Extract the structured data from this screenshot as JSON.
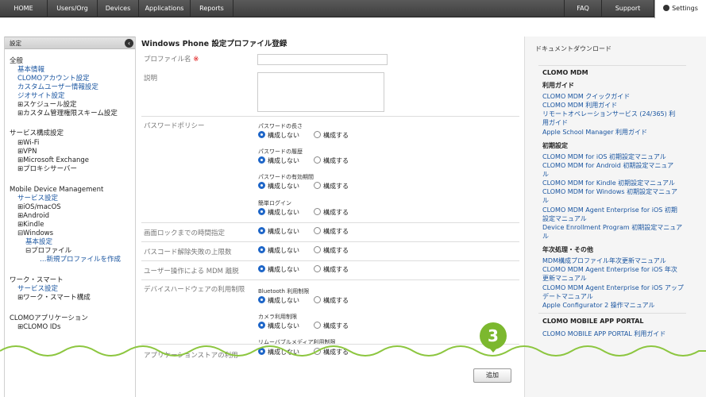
{
  "topnav": {
    "items": [
      "HOME",
      "Users/Org",
      "Devices",
      "Applications",
      "Reports",
      "FAQ",
      "Support"
    ],
    "settings": "Settings"
  },
  "sidebar": {
    "header": "設定",
    "collapse_icon": "chevron-left-icon",
    "groups": [
      {
        "title": "全般",
        "items": [
          {
            "label": "基本情報",
            "type": "link"
          },
          {
            "label": "CLOMOアカウント設定",
            "type": "link"
          },
          {
            "label": "カスタムユーザー情報設定",
            "type": "link"
          },
          {
            "label": "ジオサイト設定",
            "type": "link"
          },
          {
            "label": "⊞スケジュール設定",
            "type": "text"
          },
          {
            "label": "⊞カスタム管理権限スキーム設定",
            "type": "text"
          }
        ]
      },
      {
        "title": "サービス構成設定",
        "items": [
          {
            "label": "⊞Wi-Fi",
            "type": "text"
          },
          {
            "label": "⊞VPN",
            "type": "text"
          },
          {
            "label": "⊞Microsoft Exchange",
            "type": "text"
          },
          {
            "label": "⊞プロキシサーバー",
            "type": "text"
          }
        ]
      },
      {
        "title": "Mobile Device Management",
        "items": [
          {
            "label": "サービス設定",
            "type": "link"
          },
          {
            "label": "⊞iOS/macOS",
            "type": "text"
          },
          {
            "label": "⊞Android",
            "type": "text"
          },
          {
            "label": "⊞Kindle",
            "type": "text"
          },
          {
            "label": "⊟Windows",
            "type": "text"
          },
          {
            "label": "基本設定",
            "type": "link"
          },
          {
            "label": "⊟プロファイル",
            "type": "text"
          },
          {
            "label": "…新規プロファイルを作成",
            "type": "link"
          }
        ]
      },
      {
        "title": "ワーク・スマート",
        "items": [
          {
            "label": "サービス設定",
            "type": "link"
          },
          {
            "label": "⊞ワーク・スマート構成",
            "type": "text"
          }
        ]
      },
      {
        "title": "CLOMOアプリケーション",
        "items": [
          {
            "label": "⊞CLOMO IDs",
            "type": "text"
          }
        ]
      }
    ]
  },
  "form": {
    "title": "Windows Phone 設定プロファイル登録",
    "profile_name_label": "プロファイル名",
    "required_mark": "※",
    "description_label": "説明",
    "password_policy_label": "パスワードポリシー",
    "pw_length": "パスワードの長さ",
    "pw_history": "パスワードの履歴",
    "pw_expiry": "パスワードの有効期間",
    "simple_login": "簡単ログイン",
    "screen_lock_label": "画面ロックまでの時間指定",
    "unlock_fail_label": "パスコード解除失敗の上限数",
    "mdm_removal_label": "ユーザー操作による MDM 離脱",
    "hw_restriction_label": "デバイスハードウェアの利用制限",
    "bluetooth": "Bluetooth 利用制限",
    "camera": "カメラ利用制限",
    "removable_media": "リムーバブルメディア利用制限",
    "app_store_label": "アプリケーションストアの利用",
    "radio_off": "構成しない",
    "radio_on": "構成する",
    "add_button": "追加"
  },
  "docs": {
    "title": "ドキュメントダウンロード",
    "section": "CLOMO MDM",
    "guide_heading": "利用ガイド",
    "guide_links": [
      "CLOMO MDM クイックガイド",
      "CLOMO MDM 利用ガイド",
      "リモートオペレーションサービス (24/365) 利",
      "用ガイド",
      "Apple School Manager 利用ガイド"
    ],
    "initial_heading": "初期設定",
    "initial_links": [
      "CLOMO MDM for iOS 初期設定マニュアル",
      "CLOMO MDM for Android 初期設定マニュア",
      "ル",
      "CLOMO MDM for Kindle 初期設定マニュアル",
      "CLOMO MDM for Windows 初期設定マニュア",
      "ル",
      "CLOMO MDM Agent Enterprise for iOS 初期",
      "設定マニュアル",
      "Device Enrollment Program 初期設定マニュア",
      "ル"
    ],
    "annual_heading": "年次処理・その他",
    "annual_links": [
      "MDM構成プロファイル年次更新マニュアル",
      "CLOMO MDM Agent Enterprise for iOS 年次",
      "更新マニュアル",
      "CLOMO MDM Agent Enterprise for iOS アップ",
      "デートマニュアル",
      "Apple Configurator 2 操作マニュアル"
    ],
    "portal_heading": "CLOMO MOBILE APP PORTAL",
    "portal_links": [
      "CLOMO MOBILE APP PORTAL 利用ガイド"
    ]
  },
  "callout": {
    "number": "3",
    "color": "#7cb82f"
  }
}
